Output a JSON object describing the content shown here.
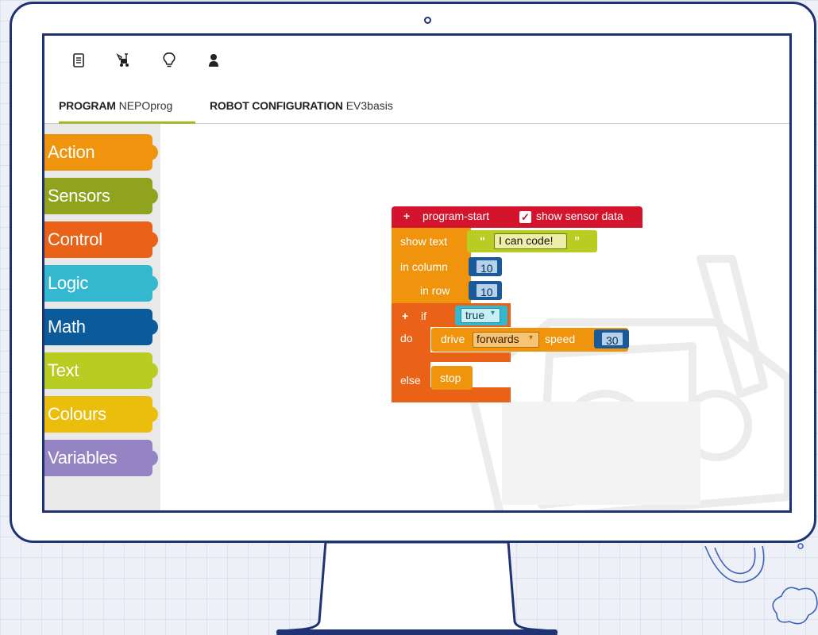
{
  "toolbar": {
    "icons": [
      "document-icon",
      "robot-icon",
      "lightbulb-icon",
      "user-icon"
    ]
  },
  "tabs": [
    {
      "bold": "PROGRAM",
      "name": "NEPOprog",
      "active": true
    },
    {
      "bold": "ROBOT CONFIGURATION",
      "name": "EV3basis",
      "active": false
    }
  ],
  "categories": [
    {
      "label": "Action",
      "color": "#f0940e"
    },
    {
      "label": "Sensors",
      "color": "#8fa31e"
    },
    {
      "label": "Control",
      "color": "#e96218"
    },
    {
      "label": "Logic",
      "color": "#33b8cf"
    },
    {
      "label": "Math",
      "color": "#0b5a9a"
    },
    {
      "label": "Text",
      "color": "#b9cc21"
    },
    {
      "label": "Colours",
      "color": "#ebbe0e"
    },
    {
      "label": "Variables",
      "color": "#9484c4"
    }
  ],
  "blocks": {
    "start": {
      "plus": "+",
      "label": "program-start",
      "checkbox_mark": "✓",
      "checkbox_label": "show sensor data",
      "color": "#d4132c"
    },
    "show_text": {
      "label": "show text",
      "quote_open": "“",
      "text_value": "I can code!",
      "quote_close": "”",
      "in_column_label": "in column",
      "column_value": "10",
      "in_row_label": "in row",
      "row_value": "10",
      "color": "#f0940e"
    },
    "if_block": {
      "plus": "+",
      "if_label": "if",
      "condition": "true",
      "do_label": "do",
      "else_label": "else",
      "color": "#e96218"
    },
    "drive": {
      "label": "drive",
      "direction": "forwards",
      "speed_label": "speed",
      "speed_value": "30",
      "color": "#f0940e"
    },
    "stop": {
      "label": "stop",
      "color": "#f0940e"
    }
  }
}
